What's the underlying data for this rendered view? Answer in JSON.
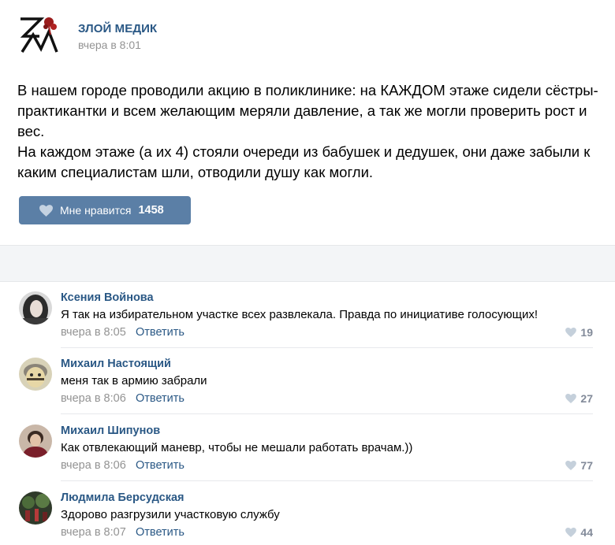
{
  "post": {
    "group_name": "ЗЛОЙ МЕДИК",
    "date": "вчера в 8:01",
    "text_lines": [
      "В нашем городе проводили акцию в поликлинике: на КАЖДОМ этаже сидели сёстры-практикантки и всем желающим меряли давление, а так же могли проверить рост и вес.",
      "На каждом этаже (а их 4) стояли очереди из бабушек и дедушек, они даже забыли к каким специалистам шли, отводили душу как могли."
    ],
    "like_label": "Мне нравится",
    "like_count": "1458"
  },
  "comments": [
    {
      "author": "Ксения Войнова",
      "text": "Я так на избирательном участке всех развлекала. Правда по инициативе голосующих!",
      "date": "вчера в 8:05",
      "reply_label": "Ответить",
      "likes": "19"
    },
    {
      "author": "Михаил Настоящий",
      "text": "меня так в армию забрали",
      "date": "вчера в 8:06",
      "reply_label": "Ответить",
      "likes": "27"
    },
    {
      "author": "Михаил Шипунов",
      "text": "Как отвлекающий маневр, чтобы не мешали работать врачам.))",
      "date": "вчера в 8:06",
      "reply_label": "Ответить",
      "likes": "77"
    },
    {
      "author": "Людмила Берсудская",
      "text": "Здорово разгрузили участковую службу",
      "date": "вчера в 8:07",
      "reply_label": "Ответить",
      "likes": "44"
    }
  ],
  "colors": {
    "link": "#2a5885",
    "like_button": "#5b7fa6",
    "meta_text": "#939393",
    "comment_like": "#828a99",
    "logo_red": "#9b1c1c"
  },
  "icons": {
    "like": "heart-icon",
    "logo": "group-logo-zm"
  }
}
